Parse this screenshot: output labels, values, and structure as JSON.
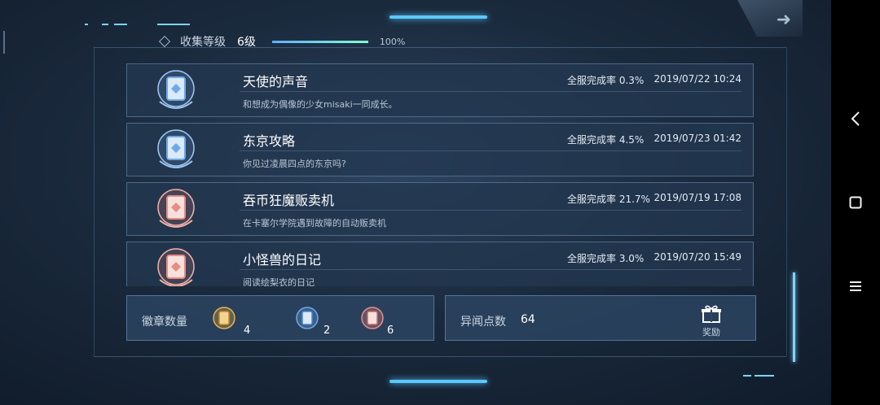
{
  "header": {
    "level_label": "收集等级",
    "level_value": "6级",
    "progress_text": "100%",
    "progress_fraction": 1.0
  },
  "cards": [
    {
      "title": "天使的声音",
      "rate": "全服完成率 0.3%",
      "date": "2019/07/22 10:24",
      "desc": "和想成为偶像的少女misaki一同成长。",
      "badge_color": "blue"
    },
    {
      "title": "东京攻略",
      "rate": "全服完成率 4.5%",
      "date": "2019/07/23 01:42",
      "desc": "你见过凌晨四点的东京吗?",
      "badge_color": "blue"
    },
    {
      "title": "吞币狂魔贩卖机",
      "rate": "全服完成率 21.7%",
      "date": "2019/07/19 17:08",
      "desc": "在卡塞尔学院遇到故障的自动贩卖机",
      "badge_color": "red"
    },
    {
      "title": "小怪兽的日记",
      "rate": "全服完成率 3.0%",
      "date": "2019/07/20 15:49",
      "desc": "阅读绘梨衣的日记",
      "badge_color": "red"
    }
  ],
  "stats": {
    "badge_label": "徽章数量",
    "gold_count": "4",
    "blue_count": "2",
    "red_count": "6",
    "points_label": "异闻点数",
    "points_value": "64",
    "reward_label": "奖励"
  },
  "colors": {
    "accent": "#5bc8ff",
    "gold": "#e8b04a",
    "blue": "#6fa8e8",
    "red": "#e88c84"
  },
  "icons": {
    "back": "back-chevron-icon",
    "home": "home-square-icon",
    "menu": "menu-lines-icon",
    "gift": "gift-icon"
  }
}
